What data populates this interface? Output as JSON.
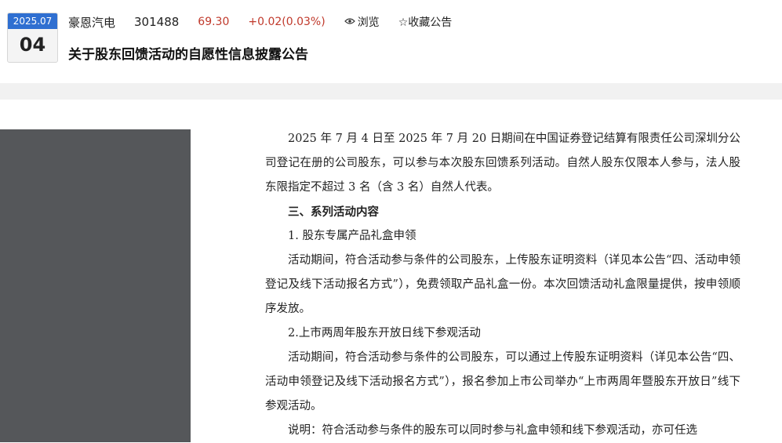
{
  "date": {
    "year_month": "2025.07",
    "day": "04"
  },
  "stock": {
    "name": "豪恩汽电",
    "code": "301488",
    "price": "69.30",
    "change": "+0.02(0.03%)"
  },
  "actions": {
    "browse_label": "浏览",
    "favorite_label": "☆收藏公告"
  },
  "title": "关于股东回馈活动的自愿性信息披露公告",
  "colors": {
    "accent": "#2f6fd1",
    "up": "#c0392b",
    "panel": "#55575a"
  },
  "body": {
    "p1": "2025 年 7 月 4 日至 2025 年 7 月 20 日期间在中国证券登记结算有限责任公司深圳分公司登记在册的公司股东，可以参与本次股东回馈系列活动。自然人股东仅限本人参与，法人股东限指定不超过 3 名（含 3 名）自然人代表。",
    "h3": "三、系列活动内容",
    "item1": "1. 股东专属产品礼盒申领",
    "p2": "活动期间，符合活动参与条件的公司股东，上传股东证明资料（详见本公告“四、活动申领登记及线下活动报名方式”），免费领取产品礼盒一份。本次回馈活动礼盒限量提供，按申领顺序发放。",
    "item2": "2.上市两周年股东开放日线下参观活动",
    "p3": "活动期间，符合活动参与条件的公司股东，可以通过上传股东证明资料（详见本公告“四、活动申领登记及线下活动报名方式”），报名参加上市公司举办“上市两周年暨股东开放日”线下参观活动。",
    "p4": "说明：符合活动参与条件的股东可以同时参与礼盒申领和线下参观活动，亦可任选"
  }
}
